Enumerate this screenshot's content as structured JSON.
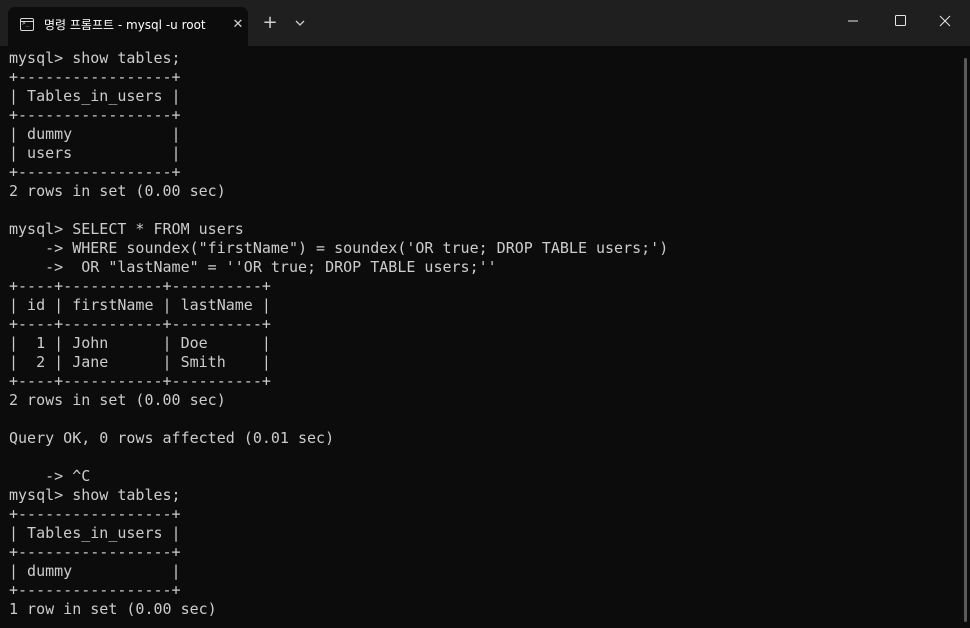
{
  "titlebar": {
    "tab_title": "명령 프롬프트 - mysql  -u root",
    "tab_icon": "command-prompt-icon",
    "close_tab_glyph": "✕",
    "new_tab_glyph": "+"
  },
  "window_controls": {
    "minimize_icon": "minimize-icon",
    "maximize_icon": "maximize-icon",
    "close_icon": "close-icon"
  },
  "colors": {
    "titlebar_bg": "#1f1f1f",
    "terminal_bg": "#0c0c0c",
    "terminal_text": "#cccccc"
  },
  "terminal": {
    "lines": [
      "mysql> show tables;",
      "+-----------------+",
      "| Tables_in_users |",
      "+-----------------+",
      "| dummy           |",
      "| users           |",
      "+-----------------+",
      "2 rows in set (0.00 sec)",
      "",
      "mysql> SELECT * FROM users",
      "    -> WHERE soundex(\"firstName\") = soundex('OR true; DROP TABLE users;')",
      "    ->  OR \"lastName\" = ''OR true; DROP TABLE users;''",
      "+----+-----------+----------+",
      "| id | firstName | lastName |",
      "+----+-----------+----------+",
      "|  1 | John      | Doe      |",
      "|  2 | Jane      | Smith    |",
      "+----+-----------+----------+",
      "2 rows in set (0.00 sec)",
      "",
      "Query OK, 0 rows affected (0.01 sec)",
      "",
      "    -> ^C",
      "mysql> show tables;",
      "+-----------------+",
      "| Tables_in_users |",
      "+-----------------+",
      "| dummy           |",
      "+-----------------+",
      "1 row in set (0.00 sec)"
    ]
  }
}
